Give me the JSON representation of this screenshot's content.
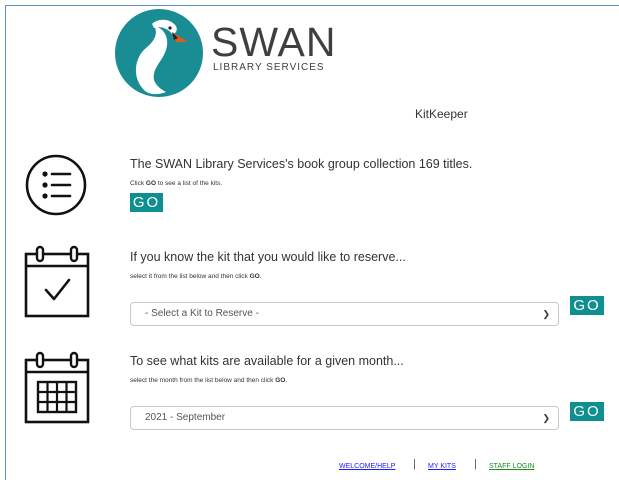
{
  "header": {
    "brand": "SWAN",
    "brand_subtitle": "LIBRARY SERVICES",
    "app_title": "KitKeeper"
  },
  "sections": [
    {
      "icon": "list-icon",
      "heading": "The SWAN Library Services's book group collection 169 titles.",
      "sub_pre": "Click ",
      "sub_bold": "GO",
      "sub_post": " to see a list of the kits.",
      "go_label": "GO"
    },
    {
      "icon": "calendar-check-icon",
      "heading": "If you know the kit that you would like to reserve...",
      "sub_pre": "select it from the list below and then click ",
      "sub_bold": "GO",
      "sub_post": ".",
      "select_value": "- Select a Kit to Reserve -",
      "go_label": "GO"
    },
    {
      "icon": "calendar-grid-icon",
      "heading": "To see what kits are available for a given month...",
      "sub_pre": "select the month from the list below and then click ",
      "sub_bold": "GO",
      "sub_post": ".",
      "select_value": "2021 - September",
      "go_label": "GO"
    }
  ],
  "footer": {
    "links": [
      {
        "label": "WELCOME/HELP",
        "color": "#1a1aff"
      },
      {
        "label": "MY KITS",
        "color": "#1a1aff"
      },
      {
        "label": "STAFF LOGIN",
        "color": "#1a8f1a"
      }
    ],
    "separator": "|"
  },
  "colors": {
    "accent": "#0f8f8f",
    "logo_teal": "#1a8c94",
    "logo_beak": "#e05a1c"
  }
}
